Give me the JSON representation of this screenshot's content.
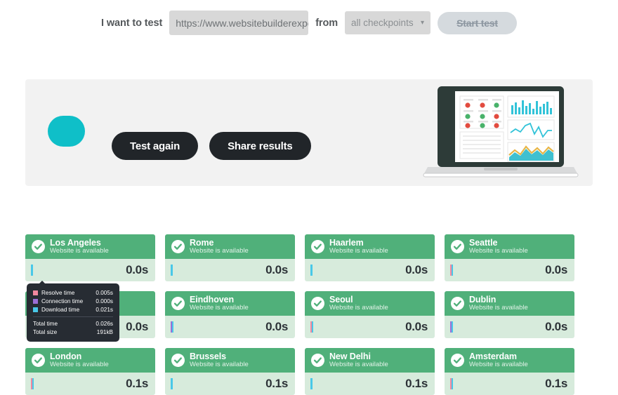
{
  "testbar": {
    "label": "I want to test",
    "url_value": "https://www.websitebuilderexpert.com",
    "url_placeholder": "https://",
    "from_label": "from",
    "checkpoint_selected": "all checkpoints",
    "checkpoint_options": [
      "all checkpoints"
    ],
    "caret_icon": "chevron-down-icon",
    "start_button": "Start test"
  },
  "banner": {
    "test_again": "Test again",
    "share_results": "Share results",
    "illustration": "laptop-dashboard-illustration",
    "accent_color": "#0fbfc8",
    "background_color": "#f2f2f2"
  },
  "colors": {
    "header_green": "#50b07a",
    "body_green": "#d7ebdc",
    "resolve": "#f2889f",
    "connection": "#9b6fd6",
    "download": "#49c8e8",
    "dark": "#212529",
    "tooltip_bg": "#272c33"
  },
  "results": {
    "status_text": "Website is available",
    "check_icon": "check-circle-icon",
    "cards": [
      {
        "city": "Los Angeles",
        "status": "Website is available",
        "time": "0.0s",
        "segments": [
          {
            "color": "#49c8e8",
            "width": 3
          }
        ]
      },
      {
        "city": "Rome",
        "status": "Website is available",
        "time": "0.0s",
        "segments": [
          {
            "color": "#49c8e8",
            "width": 3
          }
        ]
      },
      {
        "city": "Haarlem",
        "status": "Website is available",
        "time": "0.0s",
        "segments": [
          {
            "color": "#49c8e8",
            "width": 3
          }
        ]
      },
      {
        "city": "Seattle",
        "status": "Website is available",
        "time": "0.0s",
        "segments": [
          {
            "color": "#f2889f",
            "width": 2
          },
          {
            "color": "#49c8e8",
            "width": 2
          }
        ]
      },
      {
        "city": "",
        "status": "Website is available",
        "time": "0.0s",
        "segments": [
          {
            "color": "#f2889f",
            "width": 2
          },
          {
            "color": "#49c8e8",
            "width": 2
          }
        ]
      },
      {
        "city": "Eindhoven",
        "status": "Website is available",
        "time": "0.0s",
        "segments": [
          {
            "color": "#9b6fd6",
            "width": 2
          },
          {
            "color": "#49c8e8",
            "width": 2
          }
        ]
      },
      {
        "city": "Seoul",
        "status": "Website is available",
        "time": "0.0s",
        "segments": [
          {
            "color": "#f2889f",
            "width": 2
          },
          {
            "color": "#49c8e8",
            "width": 2
          }
        ]
      },
      {
        "city": "Dublin",
        "status": "Website is available",
        "time": "0.0s",
        "segments": [
          {
            "color": "#9b6fd6",
            "width": 2
          },
          {
            "color": "#49c8e8",
            "width": 2
          }
        ]
      },
      {
        "city": "London",
        "status": "Website is available",
        "time": "0.1s",
        "segments": [
          {
            "color": "#f2889f",
            "width": 2
          },
          {
            "color": "#49c8e8",
            "width": 2
          }
        ]
      },
      {
        "city": "Brussels",
        "status": "Website is available",
        "time": "0.1s",
        "segments": [
          {
            "color": "#49c8e8",
            "width": 3
          }
        ]
      },
      {
        "city": "New Delhi",
        "status": "Website is available",
        "time": "0.1s",
        "segments": [
          {
            "color": "#49c8e8",
            "width": 3
          }
        ]
      },
      {
        "city": "Amsterdam",
        "status": "Website is available",
        "time": "0.1s",
        "segments": [
          {
            "color": "#f2889f",
            "width": 2
          },
          {
            "color": "#49c8e8",
            "width": 2
          }
        ]
      }
    ]
  },
  "tooltip": {
    "rows": [
      {
        "label": "Resolve time",
        "value": "0.005s",
        "color": "#f2889f"
      },
      {
        "label": "Connection time",
        "value": "0.000s",
        "color": "#9b6fd6"
      },
      {
        "label": "Download time",
        "value": "0.021s",
        "color": "#49c8e8"
      }
    ],
    "totals": [
      {
        "label": "Total time",
        "value": "0.026s"
      },
      {
        "label": "Total size",
        "value": "191kB"
      }
    ]
  }
}
